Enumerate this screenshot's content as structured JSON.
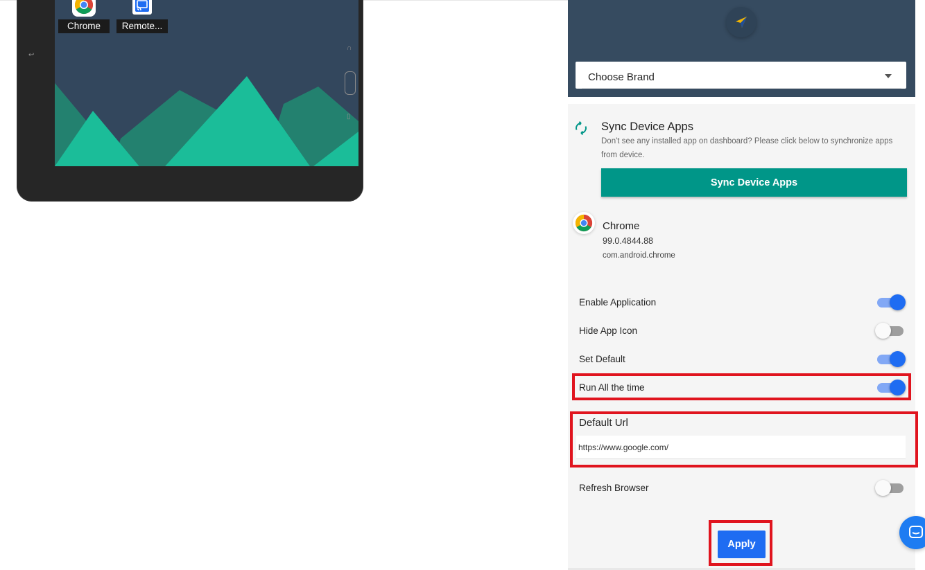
{
  "device_preview": {
    "apps": [
      {
        "label": "Chrome",
        "icon": "chrome-icon"
      },
      {
        "label": "Remote...",
        "icon": "cast-icon"
      }
    ],
    "colors": {
      "statusbar": "#13907a",
      "screen": "#33475d",
      "mountain_dark": "#23816f",
      "mountain_light": "#1bbd99"
    }
  },
  "panel": {
    "brand_select": {
      "value": "Choose Brand"
    },
    "sync": {
      "title": "Sync Device Apps",
      "description": "Don't see any installed app on dashboard? Please click below to synchronize apps from device.",
      "button_label": "Sync Device Apps"
    },
    "app": {
      "name": "Chrome",
      "version": "99.0.4844.88",
      "package": "com.android.chrome"
    },
    "settings": [
      {
        "label": "Enable Application",
        "on": true
      },
      {
        "label": "Hide App Icon",
        "on": false
      },
      {
        "label": "Set Default",
        "on": true
      },
      {
        "label": "Run All the time",
        "on": true
      }
    ],
    "default_url": {
      "label": "Default Url",
      "value": "https://www.google.com/"
    },
    "refresh_browser": {
      "label": "Refresh Browser",
      "on": false
    },
    "apply_label": "Apply"
  },
  "colors": {
    "accent": "#1e6cf2",
    "sync_button": "#009688",
    "header": "#364b60",
    "highlight": "#e0141e"
  }
}
